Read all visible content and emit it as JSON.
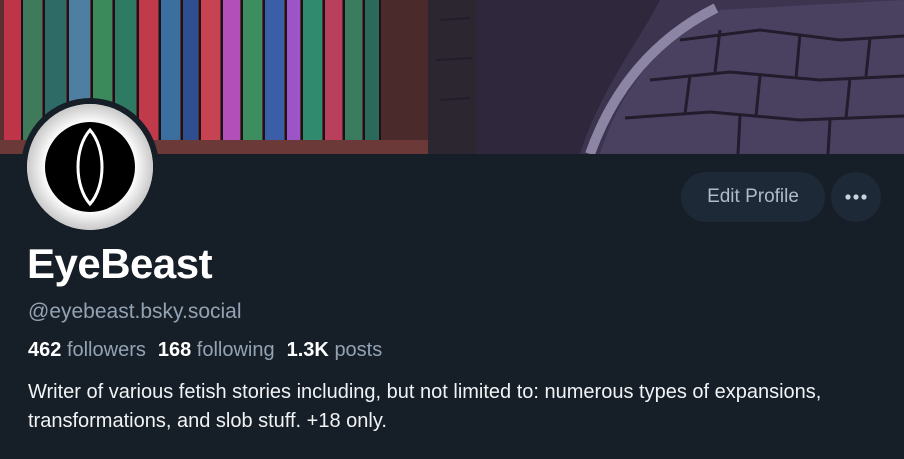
{
  "profile": {
    "display_name": "EyeBeast",
    "handle": "@eyebeast.bsky.social",
    "stats": {
      "followers_count": "462",
      "followers_label": "followers",
      "following_count": "168",
      "following_label": "following",
      "posts_count": "1.3K",
      "posts_label": "posts"
    },
    "bio": "Writer of various fetish stories including, but not limited to: numerous types of expansions, transformations, and slob stuff. +18 only."
  },
  "actions": {
    "edit_profile_label": "Edit Profile",
    "more_icon": "ellipsis-icon"
  },
  "colors": {
    "background": "#161e27",
    "button_bg": "#1e2937",
    "muted_text": "#93a3b4",
    "button_text": "#aebbc9"
  }
}
